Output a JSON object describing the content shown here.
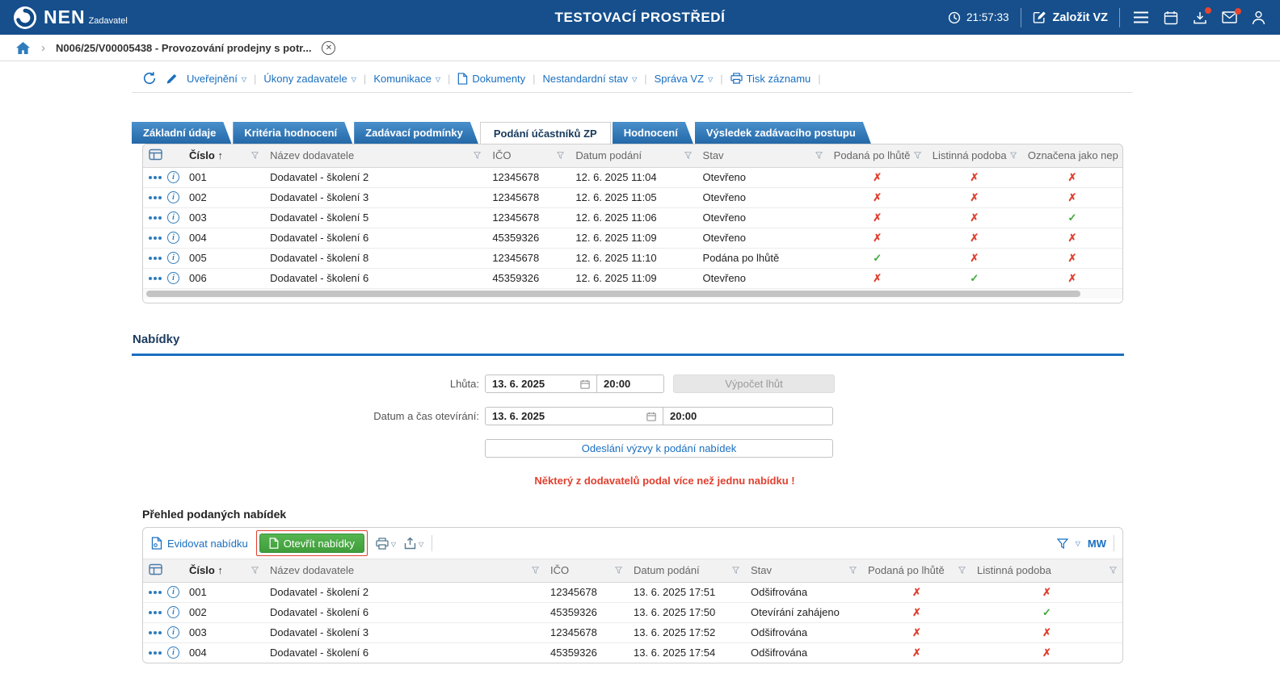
{
  "header": {
    "logo_text": "NEN",
    "logo_subtitle": "Zadavatel",
    "env_title": "TESTOVACÍ PROSTŘEDÍ",
    "clock": "21:57:33",
    "create_vz_label": "Založit VZ"
  },
  "breadcrumb": {
    "item": "N006/25/V00005438 - Provozování prodejny s potr..."
  },
  "record_toolbar": {
    "items": [
      {
        "label": "Uveřejnění",
        "dropdown": true
      },
      {
        "label": "Úkony zadavatele",
        "dropdown": true
      },
      {
        "label": "Komunikace",
        "dropdown": true
      },
      {
        "label": "Dokumenty",
        "icon": "document"
      },
      {
        "label": "Nestandardní stav",
        "dropdown": true
      },
      {
        "label": "Správa VZ",
        "dropdown": true
      },
      {
        "label": "Tisk záznamu",
        "icon": "printer"
      }
    ]
  },
  "tabs": [
    {
      "label": "Základní údaje"
    },
    {
      "label": "Kritéria hodnocení"
    },
    {
      "label": "Zadávací podmínky"
    },
    {
      "label": "Podání účastníků ZP",
      "active": true
    },
    {
      "label": "Hodnocení"
    },
    {
      "label": "Výsledek zadávacího postupu"
    }
  ],
  "submissions_table": {
    "columns": [
      {
        "label": "Číslo",
        "sorted": true
      },
      {
        "label": "Název dodavatele"
      },
      {
        "label": "IČO"
      },
      {
        "label": "Datum podání"
      },
      {
        "label": "Stav"
      },
      {
        "label": "Podaná po lhůtě",
        "type": "bool"
      },
      {
        "label": "Listinná podoba",
        "type": "bool"
      },
      {
        "label": "Označena jako nep",
        "type": "bool"
      }
    ],
    "rows": [
      [
        "001",
        "Dodavatel - školení 2",
        "12345678",
        "12. 6. 2025 11:04",
        "Otevřeno",
        false,
        false,
        false
      ],
      [
        "002",
        "Dodavatel - školení 3",
        "12345678",
        "12. 6. 2025 11:05",
        "Otevřeno",
        false,
        false,
        false
      ],
      [
        "003",
        "Dodavatel - školení 5",
        "12345678",
        "12. 6. 2025 11:06",
        "Otevřeno",
        false,
        false,
        true
      ],
      [
        "004",
        "Dodavatel - školení 6",
        "45359326",
        "12. 6. 2025 11:09",
        "Otevřeno",
        false,
        false,
        false
      ],
      [
        "005",
        "Dodavatel - školení 8",
        "12345678",
        "12. 6. 2025 11:10",
        "Podána po lhůtě",
        true,
        false,
        false
      ],
      [
        "006",
        "Dodavatel - školení 6",
        "45359326",
        "12. 6. 2025 11:09",
        "Otevřeno",
        false,
        true,
        false
      ]
    ]
  },
  "offers": {
    "section_title": "Nabídky",
    "deadline_label": "Lhůta:",
    "deadline_date": "13. 6. 2025",
    "deadline_time": "20:00",
    "compute_button": "Výpočet lhůt",
    "opening_label": "Datum a čas otevírání:",
    "opening_date": "13. 6. 2025",
    "opening_time": "20:00",
    "send_invite_button": "Odeslání výzvy k podání nabídek",
    "warning": "Některý z dodavatelů podal více než jednu nabídku !",
    "list_title": "Přehled podaných nabídek",
    "toolbar": {
      "register_label": "Evidovat nabídku",
      "open_label": "Otevřít nabídky",
      "filter_preset": "MW"
    }
  },
  "offers_table": {
    "columns": [
      {
        "label": "Číslo",
        "sorted": true
      },
      {
        "label": "Název dodavatele"
      },
      {
        "label": "IČO"
      },
      {
        "label": "Datum podání"
      },
      {
        "label": "Stav"
      },
      {
        "label": "Podaná po lhůtě",
        "type": "bool"
      },
      {
        "label": "Listinná podoba",
        "type": "bool"
      }
    ],
    "rows": [
      [
        "001",
        "Dodavatel - školení 2",
        "12345678",
        "13. 6. 2025 17:51",
        "Odšifrována",
        false,
        false
      ],
      [
        "002",
        "Dodavatel - školení 6",
        "45359326",
        "13. 6. 2025 17:50",
        "Otevírání zahájeno",
        false,
        true
      ],
      [
        "003",
        "Dodavatel - školení 3",
        "12345678",
        "13. 6. 2025 17:52",
        "Odšifrována",
        false,
        false
      ],
      [
        "004",
        "Dodavatel - školení 6",
        "45359326",
        "13. 6. 2025 17:54",
        "Odšifrována",
        false,
        false
      ]
    ]
  },
  "colors": {
    "header_bg": "#164f8c",
    "accent_blue": "#1a6fc0",
    "tab_blue": "#2f7cbd",
    "ok_green": "#3ea83a",
    "error_red": "#e0402f"
  }
}
